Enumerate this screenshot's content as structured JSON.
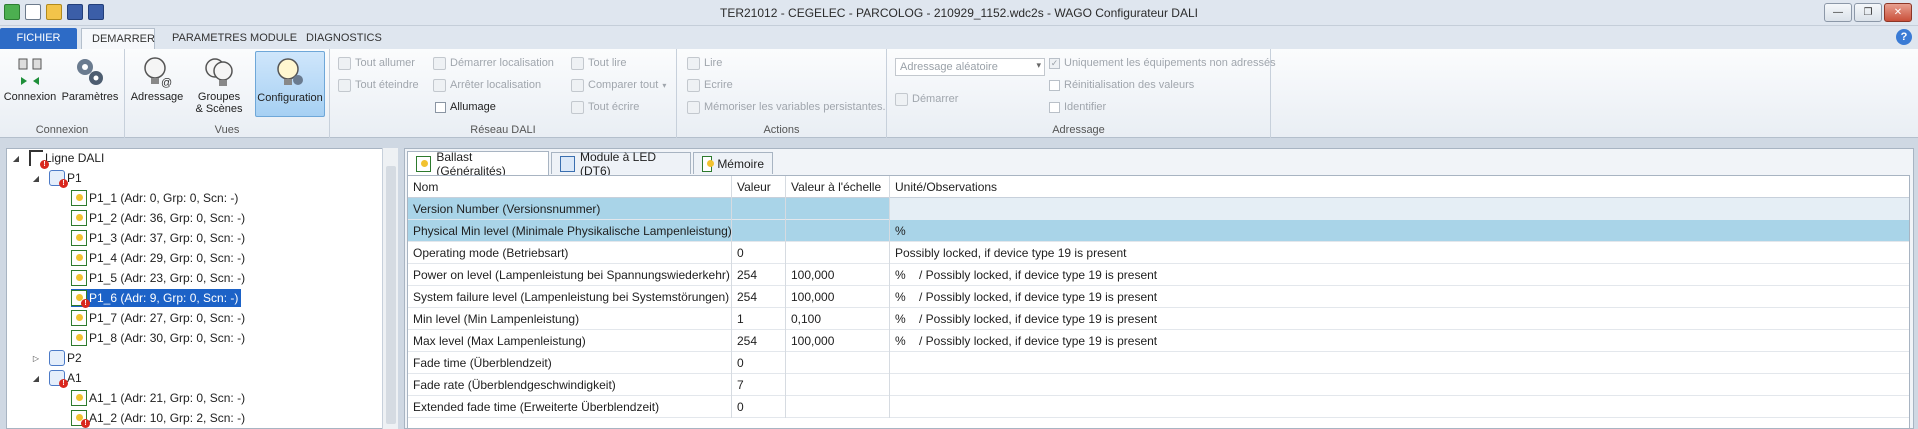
{
  "window": {
    "title": "TER21012 - CEGELEC - PARCOLOG - 210929_1152.wdc2s - WAGO Configurateur DALI"
  },
  "ribbon_tabs": [
    "FICHIER",
    "DEMARRER",
    "PARAMETRES MODULE",
    "DIAGNOSTICS"
  ],
  "groups": {
    "connexion": {
      "label": "Connexion",
      "connexion": "Connexion",
      "parametres": "Paramètres"
    },
    "vues": {
      "label": "Vues",
      "adressage": "Adressage",
      "groupes1": "Groupes",
      "groupes2": "& Scènes",
      "configuration": "Configuration"
    },
    "reseau": {
      "label": "Réseau DALI",
      "tout_allumer": "Tout allumer",
      "tout_eteindre": "Tout éteindre",
      "demarrer_loc": "Démarrer localisation",
      "arreter_loc": "Arrêter localisation",
      "allumage": "Allumage",
      "tout_lire": "Tout lire",
      "comparer_tout": "Comparer tout",
      "tout_ecrire": "Tout écrire"
    },
    "actions": {
      "label": "Actions",
      "lire": "Lire",
      "ecrire": "Ecrire",
      "memoriser": "Mémoriser les variables persistantes."
    },
    "adressage": {
      "label": "Adressage",
      "combo": "Adressage aléatoire",
      "demarrer": "Démarrer",
      "uniquement": "Uniquement les équipements non adressés",
      "reinit": "Réinitialisation des valeurs",
      "identifier": "Identifier"
    }
  },
  "tree": {
    "root": "Ligne DALI",
    "p1": "P1",
    "p1_items": [
      "P1_1 (Adr: 0, Grp: 0, Scn: -)",
      "P1_2 (Adr: 36, Grp: 0, Scn: -)",
      "P1_3 (Adr: 37, Grp: 0, Scn: -)",
      "P1_4 (Adr: 29, Grp: 0, Scn: -)",
      "P1_5 (Adr: 23, Grp: 0, Scn: -)",
      "P1_6 (Adr: 9, Grp: 0, Scn: -)",
      "P1_7 (Adr: 27, Grp: 0, Scn: -)",
      "P1_8 (Adr: 30, Grp: 0, Scn: -)"
    ],
    "p2": "P2",
    "a1": "A1",
    "a1_items": [
      "A1_1 (Adr: 21, Grp: 0, Scn: -)",
      "A1_2 (Adr: 10, Grp: 2, Scn: -)"
    ]
  },
  "detail_tabs": [
    "Ballast (Généralités)",
    "Module à LED (DT6)",
    "Mémoire"
  ],
  "table": {
    "headers": [
      "Nom",
      "Valeur",
      "Valeur à l'échelle",
      "Unité/Observations"
    ],
    "rows": [
      [
        "Version Number (Versionsnummer)",
        "",
        "",
        ""
      ],
      [
        "Physical Min level (Minimale Physikalische Lampenleistung)",
        "",
        "",
        "%"
      ],
      [
        "Operating mode (Betriebsart)",
        "0",
        "",
        "Possibly locked, if device type 19 is present"
      ],
      [
        "Power on level (Lampenleistung bei Spannungswiederkehr)",
        "254",
        "100,000",
        "%    / Possibly locked, if device type 19 is present"
      ],
      [
        "System failure level (Lampenleistung bei Systemstörungen)",
        "254",
        "100,000",
        "%    / Possibly locked, if device type 19 is present"
      ],
      [
        "Min level (Min Lampenleistung)",
        "1",
        "0,100",
        "%    / Possibly locked, if device type 19 is present"
      ],
      [
        "Max level (Max Lampenleistung)",
        "254",
        "100,000",
        "%    / Possibly locked, if device type 19 is present"
      ],
      [
        "Fade time (Überblendzeit)",
        "0",
        "",
        ""
      ],
      [
        "Fade rate (Überblendgeschwindigkeit)",
        "7",
        "",
        ""
      ],
      [
        "Extended fade time (Erweiterte Überblendzeit)",
        "0",
        "",
        ""
      ]
    ]
  }
}
